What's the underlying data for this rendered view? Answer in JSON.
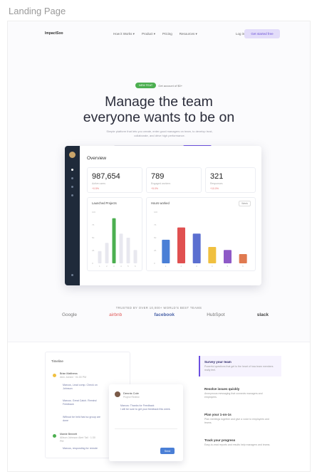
{
  "frame_label": "Landing Page",
  "nav": {
    "logo": "ImpactSoo",
    "items": [
      "How it Works ▾",
      "Product ▾",
      "Pricing",
      "Resources ▾"
    ],
    "login": "Log in",
    "cta": "Get started free"
  },
  "hero": {
    "badge": "NEW FEAT",
    "badge_text": "Get account of $0+",
    "title_line1": "Manage the team",
    "title_line2": "everyone wants to be on",
    "subtitle": "Simple platform that lets you create, enter good managers on team, to develop trust, collaborate, and drive high performance.",
    "email_placeholder": "Enter your email address",
    "cta": "Try it free"
  },
  "dashboard": {
    "heading": "Overview",
    "stats": [
      {
        "value": "987,654",
        "label": "Active users",
        "change": "+0.5%"
      },
      {
        "value": "789",
        "label": "Engaged workers",
        "change": "+5.0%"
      },
      {
        "value": "321",
        "label": "Responses",
        "change": "+10.0%"
      }
    ],
    "chart1": {
      "title": "Launched Projects"
    },
    "chart2": {
      "title": "Hours worked",
      "filter": "Week"
    }
  },
  "trusted": {
    "heading": "TRUSTED BY OVER 10,000+ WORLD'S BEST TEAMS",
    "logos": [
      "Google",
      "airbnb",
      "facebook",
      "HubSpot",
      "slack"
    ]
  },
  "timeline": {
    "title": "Timeline",
    "rows": [
      "Brian Matthews",
      "Alex Joined · 01:00 PM",
      "Marcus, Lead comp. Check on Johnson",
      "Marcus. Great Catch. Remind Feedback",
      "Without be held fast so group are done",
      "Mamie Bennett",
      "Allison Johnson Alert Tail · 1:30 PM",
      "Marcus, responding for remote"
    ]
  },
  "chat": {
    "name": "Dennis Cole",
    "role": "Project Review",
    "msg1": "Marcus: Thanks for Feedback",
    "msg2": "I will be sure to get your feedback this week.",
    "send": "Send"
  },
  "features": [
    {
      "title": "Survey your team",
      "desc": "Powerful questions that get to the heart of how team members really feel."
    },
    {
      "title": "Resolve issues quickly",
      "desc": "Anonymous messaging that connects managers and employees."
    },
    {
      "title": "Plan your 1-on-1s",
      "desc": "Plan meetings together and give a voice to employees and teams."
    },
    {
      "title": "Track your progress",
      "desc": "Easy-to-read reports and results help managers and teams."
    }
  ],
  "colors": {
    "accent": "#6c4fe0",
    "badge": "#4caf50",
    "sidebar": "#1f2a3a"
  },
  "chart_data": [
    {
      "type": "bar",
      "title": "Launched Projects",
      "categories": [
        "1",
        "2",
        "3",
        "4",
        "5",
        "6"
      ],
      "values": [
        24,
        40,
        88,
        58,
        50,
        26
      ],
      "highlight_index": 2
    },
    {
      "type": "bar",
      "title": "Hours worked",
      "categories": [
        "1",
        "2",
        "3",
        "4",
        "5",
        "6"
      ],
      "values": [
        46,
        70,
        58,
        32,
        26,
        18
      ],
      "colors": [
        "#4a7fd6",
        "#e05050",
        "#5b6fd0",
        "#f0c040",
        "#8e5ac7",
        "#e07a50"
      ]
    }
  ]
}
